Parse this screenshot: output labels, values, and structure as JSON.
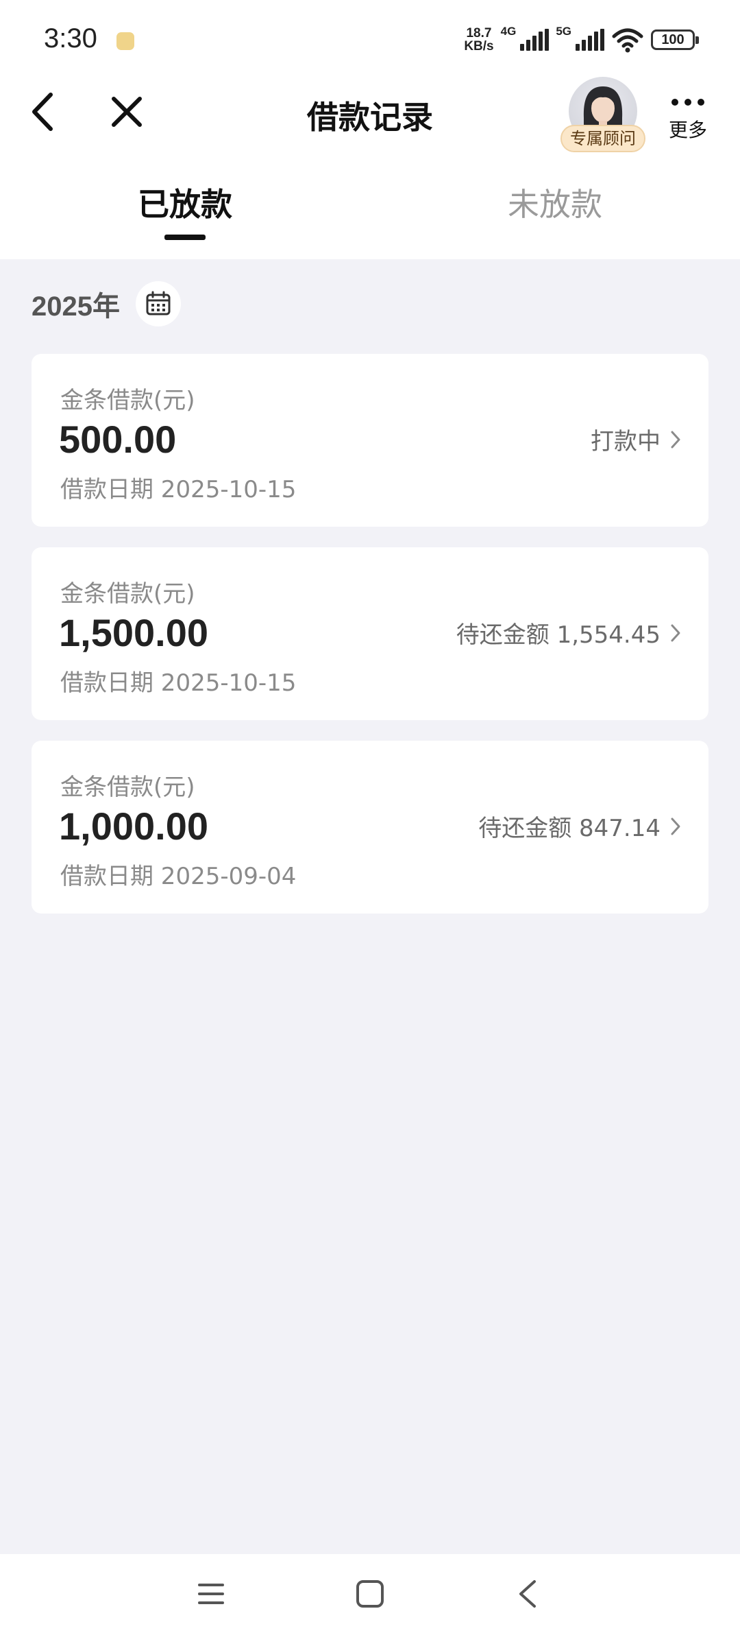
{
  "status_bar": {
    "time": "3:30",
    "net_speed_value": "18.7",
    "net_speed_unit": "KB/s",
    "net_4g": "4G",
    "net_5g": "5G",
    "battery": "100"
  },
  "nav": {
    "title": "借款记录",
    "advisor_badge": "专属顾问",
    "more_label": "更多"
  },
  "tabs": [
    {
      "label": "已放款",
      "active": true
    },
    {
      "label": "未放款",
      "active": false
    }
  ],
  "year_label": "2025年",
  "records": [
    {
      "label": "金条借款(元)",
      "amount": "500.00",
      "date": "借款日期 2025-10-15",
      "status": "打款中"
    },
    {
      "label": "金条借款(元)",
      "amount": "1,500.00",
      "date": "借款日期 2025-10-15",
      "status": "待还金额 1,554.45"
    },
    {
      "label": "金条借款(元)",
      "amount": "1,000.00",
      "date": "借款日期 2025-09-04",
      "status": "待还金额 847.14"
    }
  ]
}
